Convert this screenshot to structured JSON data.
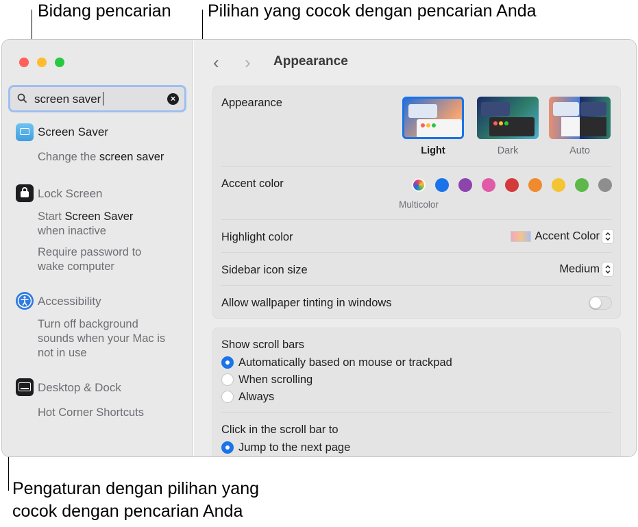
{
  "callouts": {
    "search_field": "Bidang pencarian",
    "matching_options": "Pilihan yang cocok dengan pencarian Anda",
    "settings_line1": "Pengaturan dengan pilihan yang",
    "settings_line2": "cocok dengan pencarian Anda"
  },
  "colors": {
    "accent": "#1a73e8",
    "close": "#ff5f57",
    "minimize": "#febc2e",
    "zoom": "#28c840"
  },
  "search": {
    "value": "screen saver"
  },
  "sidebar": {
    "items": [
      {
        "title": "Screen Saver",
        "icon": "screen-saver-icon",
        "subs": [
          {
            "pre": "Change the ",
            "hl": "screen saver",
            "post": ""
          }
        ]
      },
      {
        "title": "Lock Screen",
        "icon": "lock-icon",
        "subs": [
          {
            "line1_pre": "Start ",
            "line1_hl": "Screen Saver",
            "line2": "when inactive"
          },
          {
            "line1": "Require password to",
            "line2": "wake computer"
          }
        ]
      },
      {
        "title": "Accessibility",
        "icon": "accessibility-icon",
        "subs": [
          {
            "line1": "Turn off background",
            "line2": "sounds when your Mac is",
            "line3": "not in use"
          }
        ]
      },
      {
        "title": "Desktop & Dock",
        "icon": "desktop-dock-icon",
        "subs": [
          {
            "line1": "Hot Corner Shortcuts"
          }
        ]
      }
    ]
  },
  "toolbar": {
    "title": "Appearance"
  },
  "appearance": {
    "label": "Appearance",
    "options": [
      {
        "label": "Light",
        "selected": true
      },
      {
        "label": "Dark",
        "selected": false
      },
      {
        "label": "Auto",
        "selected": false
      }
    ]
  },
  "accent": {
    "label": "Accent color",
    "selected_label": "Multicolor",
    "colors": [
      "multicolor",
      "#1a73e8",
      "#8e44ad",
      "#e05aa8",
      "#d33a3a",
      "#f08a2c",
      "#f5c431",
      "#5cb84a",
      "#8e8e8e"
    ]
  },
  "highlight": {
    "label": "Highlight color",
    "value": "Accent Color"
  },
  "sidebar_icon": {
    "label": "Sidebar icon size",
    "value": "Medium"
  },
  "tinting": {
    "label": "Allow wallpaper tinting in windows",
    "enabled": false
  },
  "scrollbars": {
    "label": "Show scroll bars",
    "options": [
      {
        "label": "Automatically based on mouse or trackpad",
        "selected": true
      },
      {
        "label": "When scrolling",
        "selected": false
      },
      {
        "label": "Always",
        "selected": false
      }
    ]
  },
  "click_scroll": {
    "label": "Click in the scroll bar to",
    "options": [
      {
        "label": "Jump to the next page",
        "selected": true
      }
    ]
  }
}
